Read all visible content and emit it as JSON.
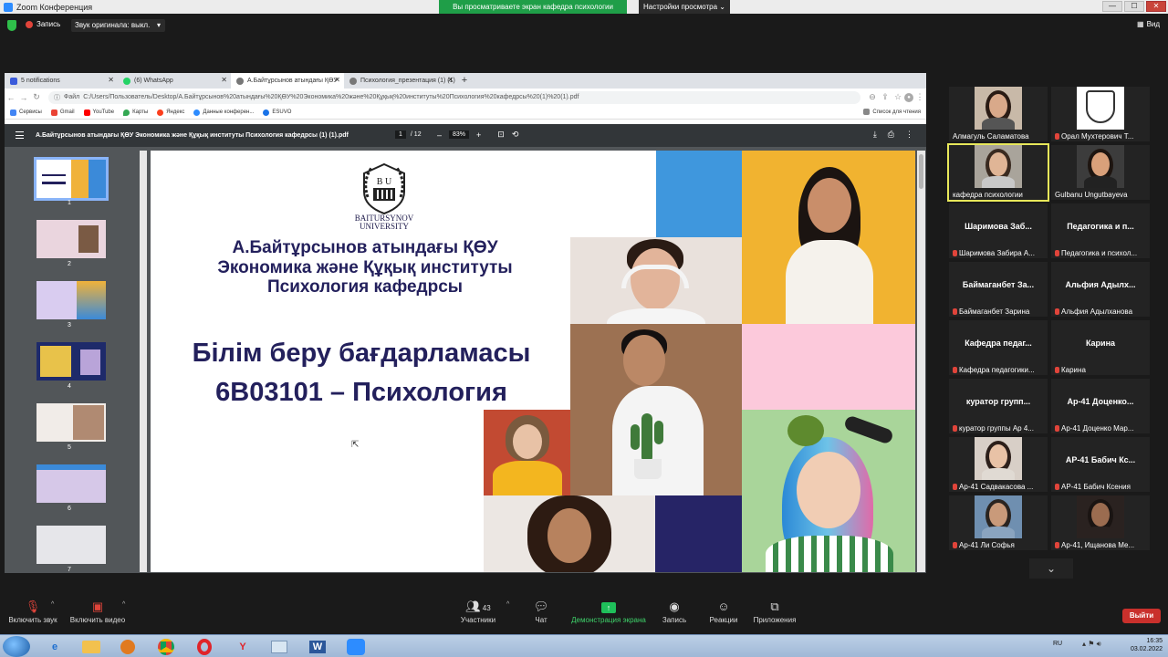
{
  "window": {
    "title": "Zoom Конференция",
    "share_banner": "Вы просматриваете экран кафедра психологии",
    "view_options": "Настройки просмотра ⌄",
    "min": "—",
    "max": "☐",
    "close": "✕"
  },
  "topstrip": {
    "record": "Запись",
    "original_audio": "Звук оригинала: выкл.",
    "view": "Вид"
  },
  "browser": {
    "tabs": [
      {
        "label": "5 notifications",
        "color": "#3b5bdb"
      },
      {
        "label": "(6) WhatsApp",
        "color": "#25d366"
      },
      {
        "label": "А.Байтұрсынов атындағы ҚӨУ",
        "color": "#777777"
      },
      {
        "label": "Психология_презентация (1) (1)",
        "color": "#777777"
      }
    ],
    "new_tab": "+",
    "back": "←",
    "forward": "→",
    "reload": "↻",
    "url_prefix": "Файл",
    "url": "C:/Users/Пользователь/Desktop/А.Байтұрсынов%20атындағы%20ҚӨУ%20Экономика%20және%20Құқық%20институты%20Психология%20кафедрсы%20(1)%20(1).pdf",
    "bookmarks": [
      {
        "label": "Сервисы",
        "color": "#4285f4"
      },
      {
        "label": "Gmail",
        "color": "#ea4335"
      },
      {
        "label": "YouTube",
        "color": "#ff0000"
      },
      {
        "label": "Карты",
        "color": "#34a853"
      },
      {
        "label": "Яндекс",
        "color": "#fc3f1d"
      },
      {
        "label": "Данные конферен...",
        "color": "#2d8cff"
      },
      {
        "label": "ESUVO",
        "color": "#1a73e8"
      }
    ],
    "reading_list": "Список для чтения"
  },
  "pdf": {
    "title": "А.Байтұрсынов атындағы ҚӨУ Экономика және Құқық институты Психология кафедрсы (1) (1).pdf",
    "page_current": "1",
    "page_total": "/ 12",
    "zoom": "83%",
    "zoom_minus": "–",
    "zoom_plus": "+",
    "thumb_numbers": [
      "1",
      "2",
      "3",
      "4",
      "5",
      "6",
      "7"
    ]
  },
  "slide": {
    "logo_line1": "BAITURSYNOV",
    "logo_line2": "UNIVERSITY",
    "logo_letters": "B U",
    "line1": "А.Байтұрсынов атындағы ҚӨУ",
    "line2": "Экономика және Құқық институты",
    "line3": "Психология кафедрсы",
    "big1": "Білім беру бағдарламасы",
    "big2": "6В03101 – Психология"
  },
  "participants": [
    {
      "name": "Алмагуль Саламатова",
      "video": true,
      "muted": false,
      "bg": "#c8b9a8",
      "skin": "#d9a98a",
      "hair": "#2a1b14",
      "shirt": "#555555"
    },
    {
      "name": "Орал Мухтерович Т...",
      "video": true,
      "muted": true,
      "bg": "#ffffff",
      "logo": true
    },
    {
      "name": "кафедра психологии",
      "video": true,
      "muted": false,
      "speaking": true,
      "bg": "#a9a49b",
      "skin": "#e0b596",
      "hair": "#3a2a20",
      "shirt": "#c8c8c8"
    },
    {
      "name": "Gulbanu Ungutbayeva",
      "video": true,
      "muted": false,
      "bg": "#3c3c3c",
      "skin": "#d9a07a",
      "hair": "#1e1510",
      "shirt": "#222222"
    },
    {
      "name": "Шаримова Забира А...",
      "big": "Шаримова Заб...",
      "muted": true
    },
    {
      "name": "Педагогика и психол...",
      "big": "Педагогика и п...",
      "muted": true
    },
    {
      "name": "Баймаганбет Зарина",
      "big": "Баймаганбет За...",
      "muted": true
    },
    {
      "name": "Альфия Адылханова",
      "big": "Альфия Адылх...",
      "muted": true
    },
    {
      "name": "Кафедра педагогики...",
      "big": "Кафедра педаг...",
      "muted": true
    },
    {
      "name": "Карина",
      "big": "Карина",
      "muted": true
    },
    {
      "name": "куратор группы Ар 4...",
      "big": "куратор групп...",
      "muted": true
    },
    {
      "name": "Ар-41 Доценко Мар...",
      "big": "Ар-41 Доценко...",
      "muted": true
    },
    {
      "name": "Ар-41 Садвакасова ...",
      "video": true,
      "muted": true,
      "bg": "#d8cfc7",
      "skin": "#e8c2a6",
      "hair": "#2c1f1a",
      "shirt": "#e0dad3"
    },
    {
      "name": "АР-41 Бабич Ксения",
      "big": "АР-41 Бабич Кс...",
      "muted": true
    },
    {
      "name": "Ар-41 Ли Софья",
      "video": true,
      "muted": true,
      "bg": "#6f8fb0",
      "skin": "#c99a7a",
      "hair": "#2a2420",
      "shirt": "#8aa4bf"
    },
    {
      "name": "Ар-41, Ищанова Ме...",
      "video": true,
      "muted": true,
      "bg": "#2a2220",
      "skin": "#9b6c50",
      "hair": "#1a1412",
      "shirt": "#2a2220"
    }
  ],
  "toolbar": {
    "unmute": "Включить звук",
    "start_video": "Включить видео",
    "participants": "Участники",
    "participants_count": "43",
    "chat": "Чат",
    "share": "Демонстрация экрана",
    "record": "Запись",
    "reactions": "Реакции",
    "apps": "Приложения",
    "leave": "Выйти"
  },
  "taskbar": {
    "lang": "RU",
    "time": "16:35",
    "date": "03.02.2022",
    "word_letter": "W"
  }
}
